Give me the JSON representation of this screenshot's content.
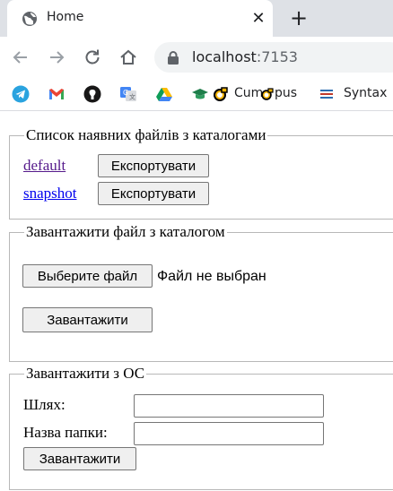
{
  "browser": {
    "tab": {
      "title": "Home",
      "close": "✕"
    },
    "new_tab": "+",
    "address": {
      "host": "localhost",
      "port": ":7153"
    },
    "bookmarks": [
      {
        "icon": "telegram-icon",
        "label": ""
      },
      {
        "icon": "gmail-icon",
        "label": ""
      },
      {
        "icon": "github-icon",
        "label": ""
      },
      {
        "icon": "google-translate-icon",
        "label": ""
      },
      {
        "icon": "google-drive-icon",
        "label": ""
      },
      {
        "icon": "graduation-cap-icon",
        "label": ""
      },
      {
        "icon": "campus-icon",
        "label": "Cum⁠pus"
      },
      {
        "icon": "menu-lines-icon",
        "label": "Syntax"
      }
    ],
    "campus_label_parts": [
      "Cum",
      "pus"
    ]
  },
  "catalog_list": {
    "legend": "Список наявних файлів з каталогами",
    "items": [
      {
        "name": "default",
        "visited": true,
        "export_label": "Експортувати"
      },
      {
        "name": "snapshot",
        "visited": false,
        "export_label": "Експортувати"
      }
    ]
  },
  "upload_file": {
    "legend": "Завантажити файл з каталогом",
    "choose_label": "Выберите файл",
    "file_status": "Файл не выбран",
    "submit_label": "Завантажити"
  },
  "upload_os": {
    "legend": "Завантажити з ОС",
    "path_label": "Шлях:",
    "path_value": "",
    "folder_label": "Назва папки:",
    "folder_value": "",
    "submit_label": "Завантажити"
  },
  "colors": {
    "tabstrip": "#dee1e6",
    "link": "#0000ee",
    "link_visited": "#551a8b",
    "button_bg": "#efefef"
  }
}
